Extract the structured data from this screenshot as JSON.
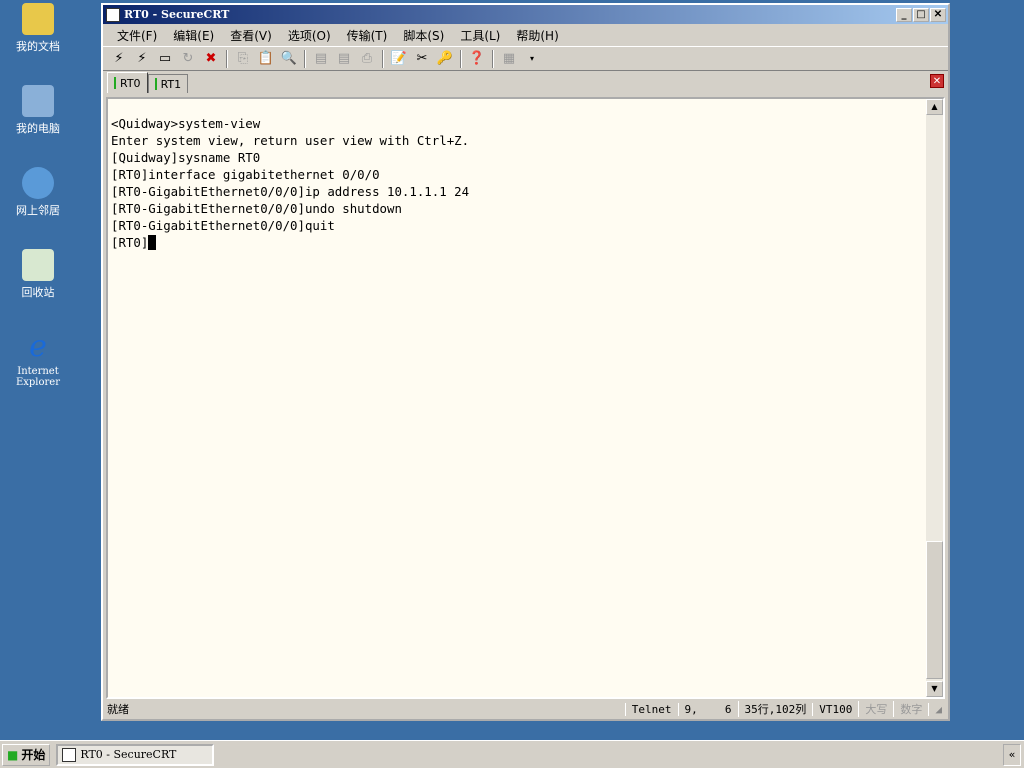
{
  "desktop": [
    "我的文档",
    "我的电脑",
    "网上邻居",
    "回收站",
    "Internet Explorer"
  ],
  "window": {
    "title": "RT0 - SecureCRT"
  },
  "menu": [
    "文件(F)",
    "编辑(E)",
    "查看(V)",
    "选项(O)",
    "传输(T)",
    "脚本(S)",
    "工具(L)",
    "帮助(H)"
  ],
  "tabs": [
    "RT0",
    "RT1"
  ],
  "terminal": {
    "lines": [
      "<Quidway>system-view",
      "Enter system view, return user view with Ctrl+Z.",
      "[Quidway]sysname RT0",
      "[RT0]interface gigabitethernet 0/0/0",
      "[RT0-GigabitEthernet0/0/0]ip address 10.1.1.1 24",
      "[RT0-GigabitEthernet0/0/0]undo shutdown",
      "[RT0-GigabitEthernet0/0/0]quit"
    ],
    "prompt": "[RT0]"
  },
  "status": {
    "ready": "就绪",
    "protocol": "Telnet",
    "row": "9,",
    "col": "6",
    "size": "35行,102列",
    "emulation": "VT100",
    "caps": "大写",
    "num": "数字"
  },
  "taskbar": {
    "start": "开始",
    "task": "RT0 - SecureCRT",
    "tray": "«"
  }
}
